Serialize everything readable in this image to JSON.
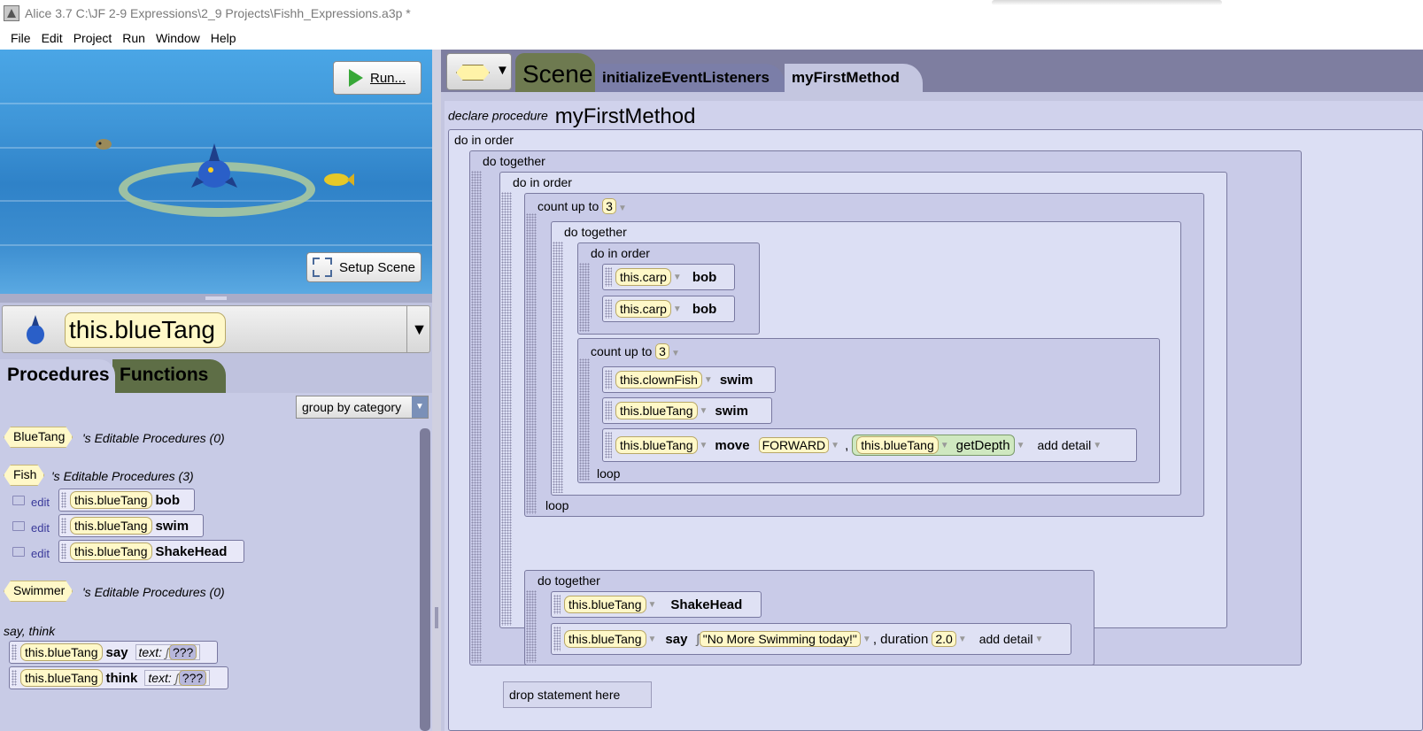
{
  "window": {
    "title": "Alice 3.7 C:\\JF 2-9 Expressions\\2_9 Projects\\Fishh_Expressions.a3p *"
  },
  "menu": [
    {
      "label": "File"
    },
    {
      "label": "Edit"
    },
    {
      "label": "Project"
    },
    {
      "label": "Run"
    },
    {
      "label": "Window"
    },
    {
      "label": "Help"
    }
  ],
  "scene": {
    "run_label": "Run...",
    "setup_label": "Setup Scene"
  },
  "selector": {
    "object": "this.blueTang"
  },
  "tabs_left": {
    "procedures": "Procedures",
    "functions": "Functions"
  },
  "group": {
    "value": "group by category"
  },
  "procedures": {
    "classes": [
      {
        "name": "BlueTang",
        "suffix": "'s Editable Procedures (0)"
      },
      {
        "name": "Fish",
        "suffix": "'s Editable Procedures (3)"
      },
      {
        "name": "Swimmer",
        "suffix": "'s Editable Procedures (0)"
      }
    ],
    "edit_label": "edit",
    "fish_methods": [
      {
        "obj": "this.blueTang",
        "method": "bob"
      },
      {
        "obj": "this.blueTang",
        "method": "swim"
      },
      {
        "obj": "this.blueTang",
        "method": "ShakeHead"
      }
    ],
    "category": "say, think",
    "say_think": [
      {
        "obj": "this.blueTang",
        "method": "say",
        "param": "text:",
        "value": "???"
      },
      {
        "obj": "this.blueTang",
        "method": "think",
        "param": "text:",
        "value": "???"
      }
    ]
  },
  "editor_tabs": {
    "scene": "Scene",
    "init": "initializeEventListeners",
    "first": "myFirstMethod"
  },
  "code": {
    "declare": "declare procedure",
    "method_name": "myFirstMethod",
    "do_in_order": "do in order",
    "do_together": "do together",
    "count_up_to": "count up to",
    "count_value": "3",
    "loop": "loop",
    "carp": "this.carp",
    "bob": "bob",
    "clownfish": "this.clownFish",
    "blue": "this.blueTang",
    "swim": "swim",
    "move": "move",
    "forward": "FORWARD",
    "getdepth": "getDepth",
    "add_detail": "add detail",
    "shakehead": "ShakeHead",
    "say": "say",
    "say_text": "\"No More Swimming today!\"",
    "duration_label": ", duration",
    "duration_value": "2.0",
    "comma": ",",
    "drop": "drop statement here"
  }
}
